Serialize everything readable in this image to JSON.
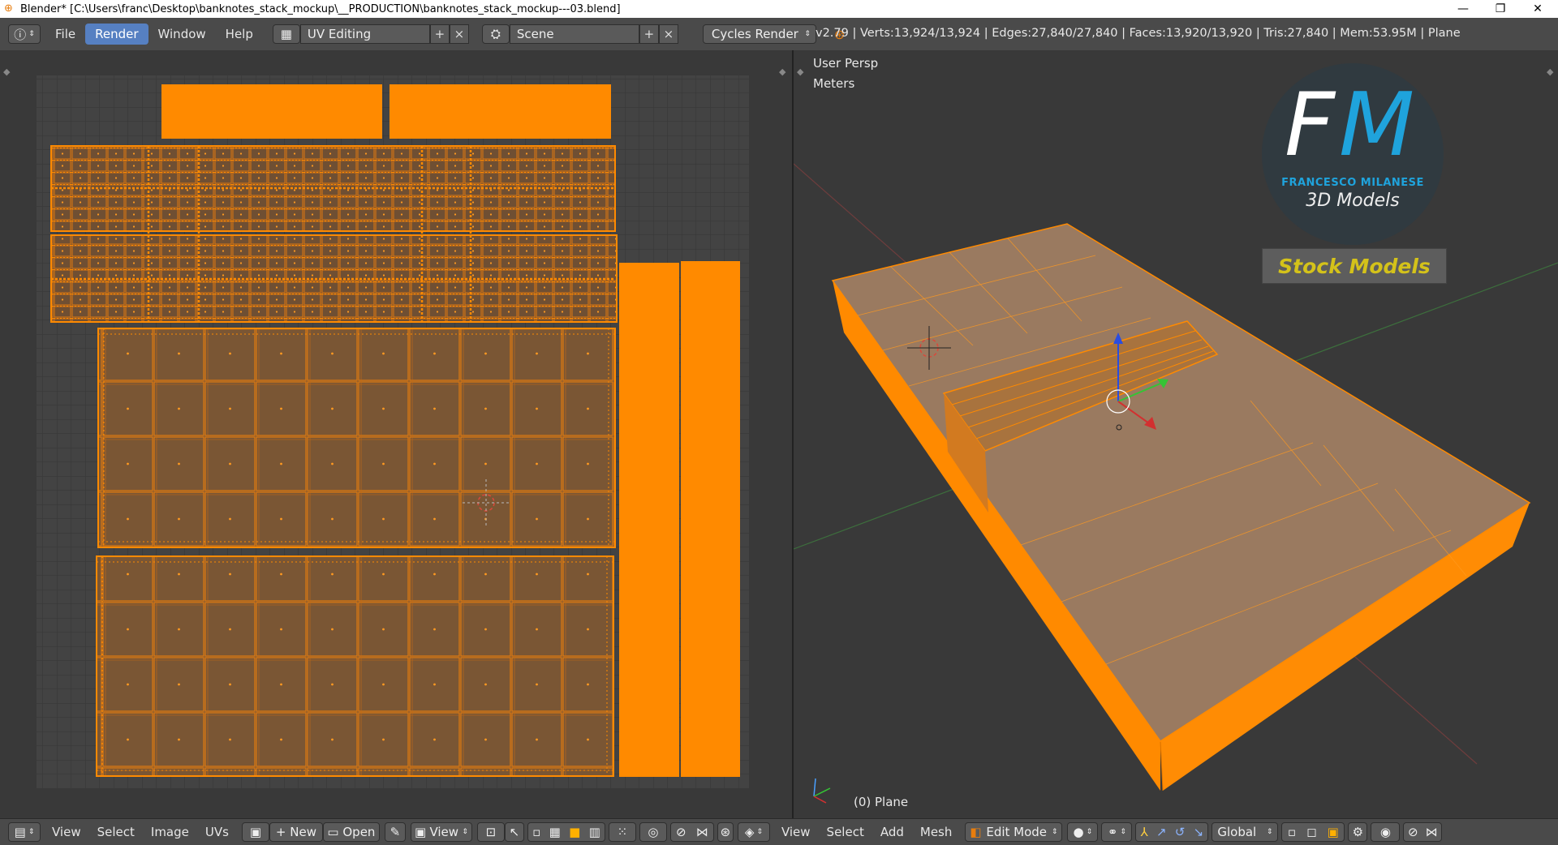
{
  "window": {
    "title": "Blender* [C:\\Users\\franc\\Desktop\\banknotes_stack_mockup\\__PRODUCTION\\banknotes_stack_mockup---03.blend]",
    "controls": [
      "—",
      "❐",
      "✕"
    ]
  },
  "menu": {
    "items": [
      "File",
      "Render",
      "Window",
      "Help"
    ],
    "active": "Render"
  },
  "screen_layout": "UV Editing",
  "scene": "Scene",
  "render_engine": "Cycles Render",
  "stats": "v2.79 | Verts:13,924/13,924 | Edges:27,840/27,840 | Faces:13,920/13,920 | Tris:27,840 | Mem:53.95M | Plane",
  "viewport": {
    "view_label": "User Persp",
    "units": "Meters",
    "object_label": "(0) Plane"
  },
  "watermark": {
    "initials_f": "F",
    "initials_m": "M",
    "author": "FRANCESCO MILANESE",
    "subtitle": "3D Models",
    "banner": "Stock Models"
  },
  "uv_header": {
    "menus": [
      "View",
      "Select",
      "Image",
      "UVs"
    ],
    "new_label": "New",
    "open_label": "Open",
    "view_label": "View"
  },
  "view3d_header": {
    "menus": [
      "View",
      "Select",
      "Add",
      "Mesh"
    ],
    "mode": "Edit Mode",
    "orientation": "Global"
  },
  "colors": {
    "accent": "#ff8a00",
    "active_menu": "#5680c2",
    "stock_text": "#d4c21a",
    "logo_blue": "#1fa3dc"
  }
}
